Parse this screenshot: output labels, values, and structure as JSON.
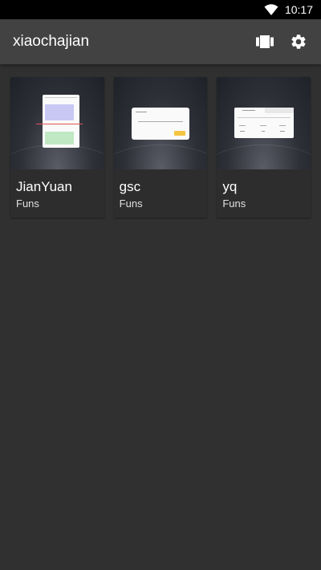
{
  "status_bar": {
    "time": "10:17",
    "wifi_icon": "wifi-icon"
  },
  "app_bar": {
    "title": "xiaochajian",
    "actions": [
      {
        "name": "view-carousel-icon"
      },
      {
        "name": "settings-gear-icon"
      }
    ]
  },
  "colors": {
    "background": "#303030",
    "app_bar": "#424242",
    "card_info": "#2d2d2d",
    "accent_yellow": "#f5c542"
  },
  "cards": [
    {
      "name": "JianYuan",
      "subtitle": "Funs"
    },
    {
      "name": "gsc",
      "subtitle": "Funs"
    },
    {
      "name": "yq",
      "subtitle": "Funs"
    }
  ]
}
